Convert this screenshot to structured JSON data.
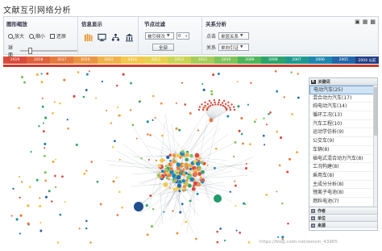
{
  "page": {
    "title": "文献互引网络分析"
  },
  "toolbar": {
    "corner_icons": [
      "camera-icon",
      "image-icon",
      "grid-icon"
    ],
    "zoom": {
      "title": "图形缩放",
      "zoom_in": "放大",
      "zoom_out": "缩小",
      "restore": "还原",
      "ball_label": "球面"
    },
    "info": {
      "title": "信息显示",
      "icons": [
        "books-icon",
        "monitor-icon",
        "hierarchy-icon",
        "institution-icon"
      ]
    },
    "filter": {
      "title": "节点过滤",
      "mode_value": "被引频次",
      "count_value": "0",
      "all_label": "全部"
    },
    "relation": {
      "title": "关系分析",
      "row1_label": "点击",
      "row1_value": "单层关系",
      "row2_label": "关系",
      "row2_value": "单向引证"
    }
  },
  "timeline": {
    "years": [
      "2019",
      "2018",
      "2017",
      "2016",
      "2015",
      "2014",
      "2013",
      "2012",
      "2011",
      "2010",
      "2009",
      "2008",
      "2007",
      "2006",
      "2005",
      "2004 以前"
    ],
    "colors": [
      "#d94a3c",
      "#e0623c",
      "#e57a3e",
      "#e99542",
      "#efb24a",
      "#f2c84f",
      "#e6d251",
      "#c9d456",
      "#a6cc59",
      "#7ec35b",
      "#4fb55a",
      "#2ea46b",
      "#1f9a8f",
      "#1f87b0",
      "#2566a8",
      "#243f86"
    ]
  },
  "keywords_panel": {
    "header_badge": "K",
    "header_label": "关键词",
    "items": [
      "电动汽车(25)",
      "混合动力汽车(17)",
      "纯电动汽车(14)",
      "循环工况(13)",
      "汽车工程(10)",
      "运动学仿析(9)",
      "公交车(9)",
      "车辆(8)",
      "插电式混合动力汽车(8)",
      "工况构建(8)",
      "乘用车(8)",
      "主成分分析(8)",
      "锂离子电池(8)",
      "燃料电池(7)"
    ],
    "selected_index": 0,
    "sections": [
      {
        "label": "作者"
      },
      {
        "label": "单位"
      },
      {
        "label": "来源"
      }
    ]
  },
  "watermark": "https://blog.csdn.net/weixin_43965"
}
